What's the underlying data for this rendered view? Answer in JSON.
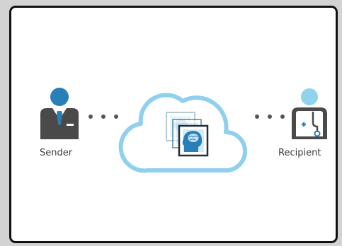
{
  "nodes": {
    "sender": {
      "label": "Sender",
      "icon": "businessman-icon"
    },
    "cloud": {
      "icon": "cloud-icon",
      "contents": "brain-scan-image-stack-icon"
    },
    "recipient": {
      "label": "Recipient",
      "icon": "doctor-stethoscope-icon"
    }
  },
  "connectors": [
    {
      "from": "sender",
      "to": "cloud",
      "style": "dotted"
    },
    {
      "from": "cloud",
      "to": "recipient",
      "style": "dotted"
    }
  ],
  "colors": {
    "background": "#d3d3d3",
    "panel": "#ffffff",
    "border": "#111111",
    "sender_head": "#2b7fb8",
    "sender_body": "#4a4a4a",
    "cloud_stroke": "#8fd0ef",
    "recipient_head": "#8fd3ef",
    "recipient_body": "#4a4a4a",
    "dots": "#555555",
    "label_text": "#3a3a3a"
  }
}
